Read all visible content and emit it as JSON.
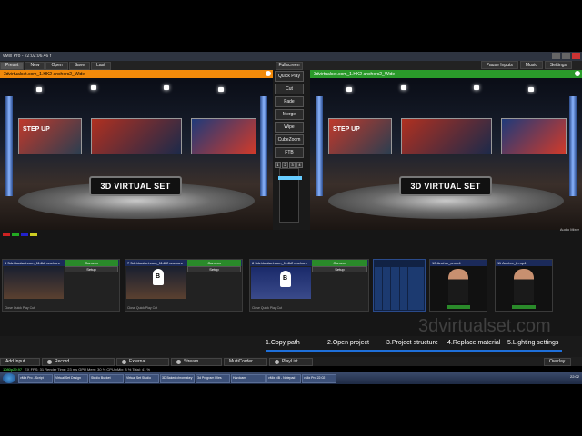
{
  "window": {
    "title": "vMix Pro - 22:02:06.46 f"
  },
  "toolbar": {
    "preset": "Preset",
    "new": "New",
    "open": "Open",
    "save": "Save",
    "last": "Last",
    "fullscreen": "Fullscreen",
    "pause_inputs": "Pause Inputs",
    "music": "Music",
    "settings": "Settings"
  },
  "preview": {
    "left_label": "3dvirtualset.com_1.HK2 anchors2_Wide",
    "right_label": "3dvirtualset.com_1.HK2 anchors2_Wide"
  },
  "set": {
    "desk_text": "3D VIRTUAL SET",
    "screen_text": "STEP UP"
  },
  "transitions": {
    "buttons": [
      "Quick Play",
      "Cut",
      "Fade",
      "Merge",
      "Wipe",
      "CubeZoom",
      "FTB"
    ],
    "numbers": [
      "1",
      "2",
      "3",
      "4"
    ]
  },
  "colors": {
    "orange": "#f28a0a",
    "green": "#2a9a2a",
    "accent_blue": "#1e6fd9"
  },
  "audio_label": "Audio Mixer",
  "inputs": [
    {
      "num": "6",
      "name": "3dvirtualset.com_114k2 anchors",
      "camera": "Camera",
      "setup": "Setup",
      "info": "Close Quick Play Cut"
    },
    {
      "num": "7",
      "name": "3dvirtualset.com_114k2 anchors",
      "camera": "Camera",
      "setup": "Setup",
      "info": "Close Quick Play Cut"
    },
    {
      "num": "8",
      "name": "3dvirtualset.com_114k2 anchors",
      "camera": "Camera",
      "setup": "Setup",
      "info": "Close Quick Play Cut"
    }
  ],
  "anchors": [
    {
      "num": "10",
      "name": "Anchor_a.mp4"
    },
    {
      "num": "11",
      "name": "Anchor_b.mp4"
    }
  ],
  "watermark": "3dvirtualset.com",
  "steps": [
    "1.Copy path",
    "2.Open project",
    "3.Project structure",
    "4.Replace material",
    "5.Lighting settings"
  ],
  "bottom": {
    "add_input": "Add Input",
    "record": "Record",
    "external": "External",
    "stream": "Stream",
    "multicorder": "MultiCorder",
    "playlist": "PlayList",
    "overlay": "Overlay"
  },
  "perf": {
    "fps": "1080p29.97",
    "stats": "EX  FPS: 31  Render Time: 23 ms  GPU Mem: 30 %  CPU vMix: 8 %  Total: 41 %"
  },
  "taskbar": {
    "tasks": [
      "vMix Pro - Script",
      "Virtual Set Design",
      "Studio Bucket",
      "Virtual Set Studio",
      "3D Baked chromakey",
      "3d Program Files",
      "Hardcam",
      "vMix NB - Notepad",
      "vMix Pro 22:02"
    ],
    "clock": "22:02"
  }
}
